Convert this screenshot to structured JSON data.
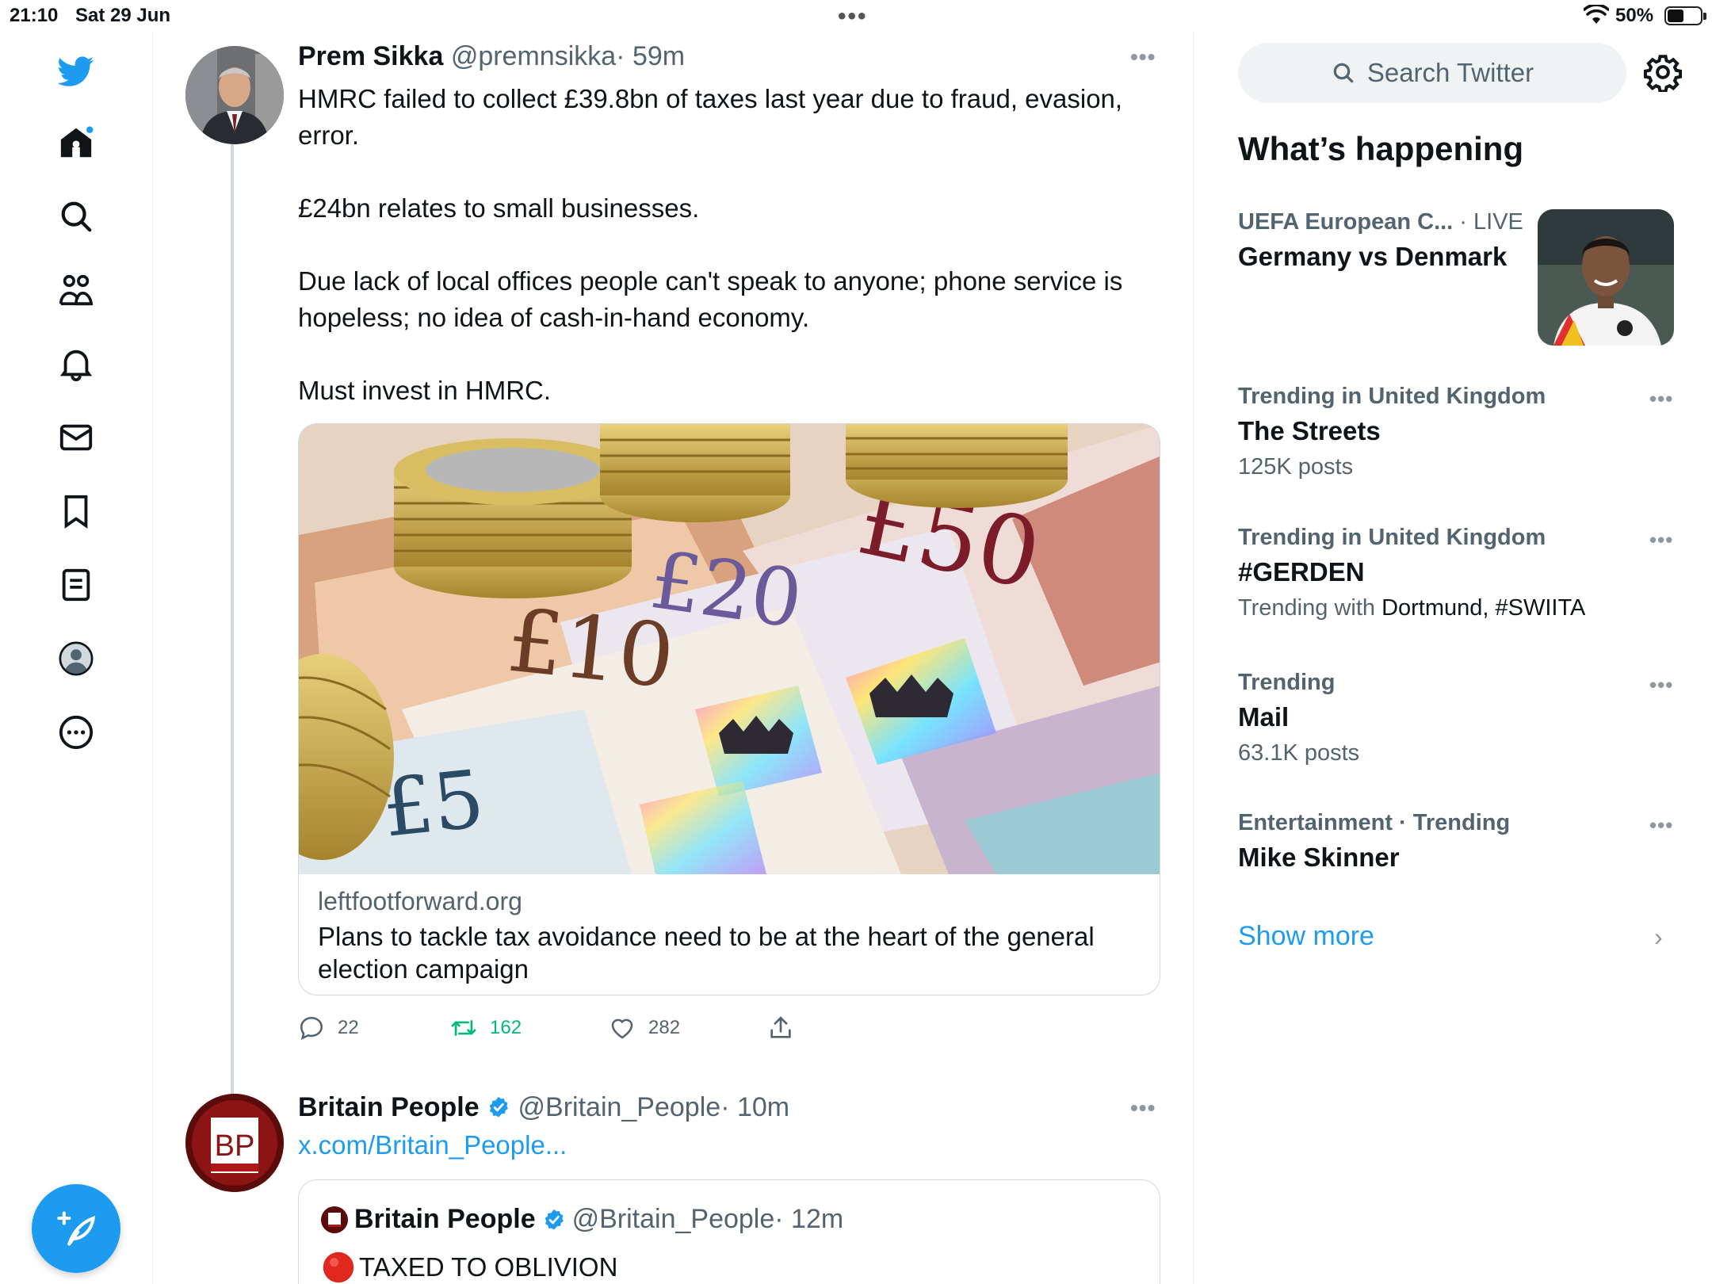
{
  "status_bar": {
    "time": "21:10",
    "date": "Sat 29 Jun",
    "battery": "50%"
  },
  "nav": {
    "items": [
      "home-icon",
      "search-icon",
      "communities-icon",
      "notifications-icon",
      "messages-icon",
      "bookmarks-icon",
      "lists-icon",
      "profile-icon",
      "more-icon"
    ],
    "compose": "compose-tweet-icon",
    "accent": "#1d9bf0"
  },
  "tweet1": {
    "name": "Prem Sikka",
    "handle": "@premnsikka",
    "time": "· 59m",
    "text_lines": [
      "HMRC failed to collect £39.8bn of taxes last year due to fraud, evasion, error.",
      "£24bn relates to small businesses.",
      "Due lack of local offices people can't speak to anyone; phone service is hopeless; no idea of cash-in-hand economy.",
      "Must invest in HMRC."
    ],
    "card": {
      "domain": "leftfootforward.org",
      "title": "Plans to tackle tax avoidance need to be at the heart of the general election campaign",
      "image_labels": {
        "note_50": "£50",
        "note_20": "£20",
        "note_10": "£10",
        "note_5": "£5"
      }
    },
    "actions": {
      "replies": "22",
      "retweets": "162",
      "likes": "282"
    }
  },
  "tweet2": {
    "name": "Britain People",
    "handle": "@Britain_People",
    "time": "· 10m",
    "avatar_text": "BP",
    "link": "x.com/Britain_People...",
    "quote": {
      "name": "Britain People",
      "handle": "@Britain_People",
      "time": "· 12m",
      "text": "TAXED TO OBLIVION"
    }
  },
  "sidebar": {
    "search_placeholder": "Search Twitter",
    "section_title": "What’s happening",
    "trends": [
      {
        "meta": "UEFA European C...",
        "meta_suffix": " · LIVE",
        "title": "Germany vs Denmark"
      },
      {
        "meta": "Trending in United Kingdom",
        "title": "The Streets",
        "sub": "125K posts"
      },
      {
        "meta": "Trending in United Kingdom",
        "title": "#GERDEN",
        "sub_prefix": "Trending with ",
        "sub_dark": "Dortmund, #SWIITA"
      },
      {
        "meta": "Trending",
        "title": "Mail",
        "sub": "63.1K posts"
      },
      {
        "meta": "Entertainment · Trending",
        "title": "Mike Skinner"
      }
    ],
    "show_more": "Show more"
  }
}
